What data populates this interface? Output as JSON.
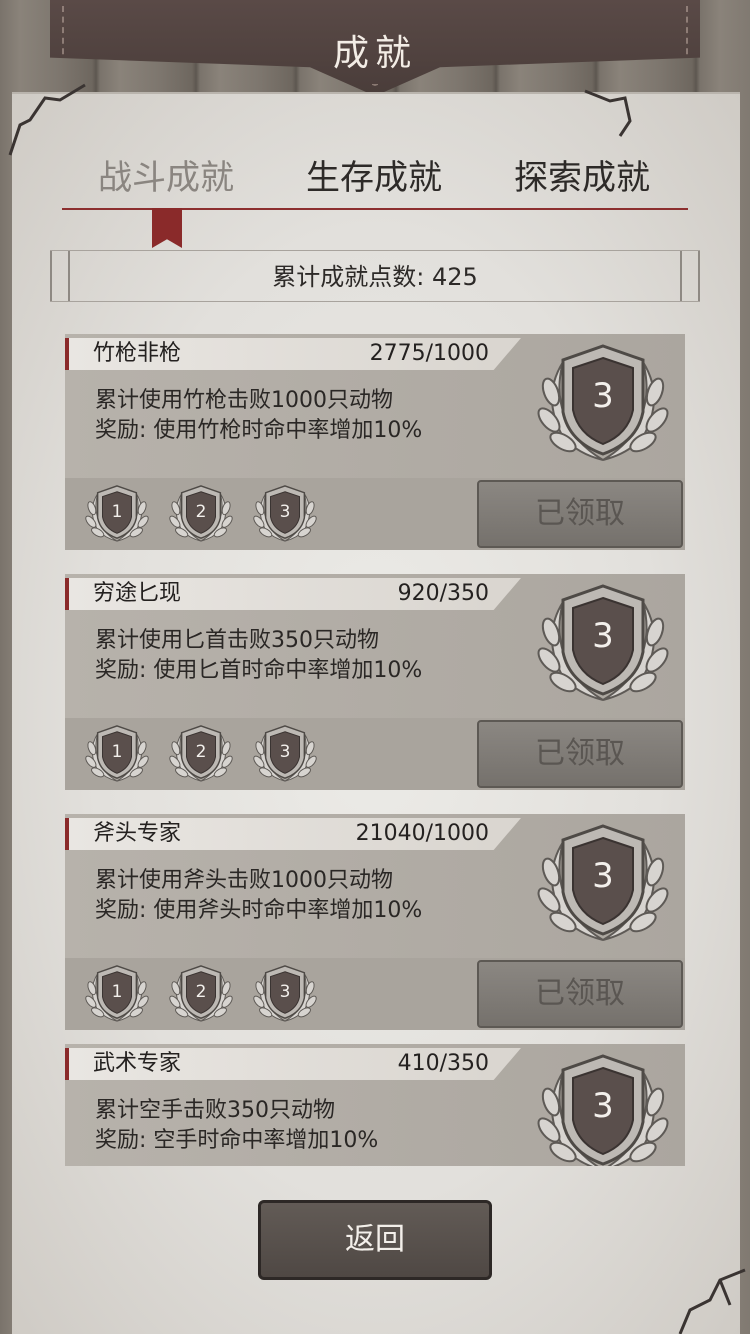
{
  "header": {
    "title": "成就"
  },
  "tabs": [
    {
      "label": "战斗成就",
      "active": true
    },
    {
      "label": "生存成就",
      "active": false
    },
    {
      "label": "探索成就",
      "active": false
    }
  ],
  "points": {
    "text": "累计成就点数: 425"
  },
  "cards": [
    {
      "name": "竹枪非枪",
      "progress": "2775/1000",
      "desc_line1": "累计使用竹枪击败1000只动物",
      "desc_line2": "奖励: 使用竹枪时命中率增加10%",
      "level": "3",
      "tiers": [
        "1",
        "2",
        "3"
      ],
      "button": "已领取"
    },
    {
      "name": "穷途匕现",
      "progress": "920/350",
      "desc_line1": "累计使用匕首击败350只动物",
      "desc_line2": "奖励: 使用匕首时命中率增加10%",
      "level": "3",
      "tiers": [
        "1",
        "2",
        "3"
      ],
      "button": "已领取"
    },
    {
      "name": "斧头专家",
      "progress": "21040/1000",
      "desc_line1": "累计使用斧头击败1000只动物",
      "desc_line2": "奖励: 使用斧头时命中率增加10%",
      "level": "3",
      "tiers": [
        "1",
        "2",
        "3"
      ],
      "button": "已领取"
    },
    {
      "name": "武术专家",
      "progress": "410/350",
      "desc_line1": "累计空手击败350只动物",
      "desc_line2": "奖励: 空手时命中率增加10%",
      "level": "3"
    }
  ],
  "back_button": "返回",
  "colors": {
    "accent_red": "#8a2a2a",
    "paper": "#e2e0dc",
    "header_leather": "#4a3d3a",
    "badge_silver": "#c9c6c2"
  }
}
